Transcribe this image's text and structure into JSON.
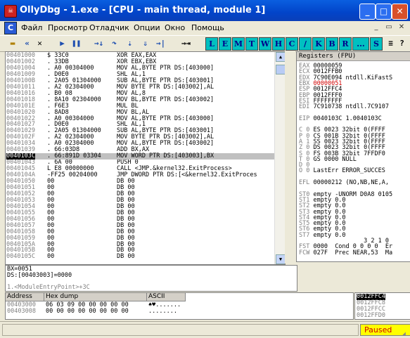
{
  "window": {
    "title": "OllyDbg - 1.exe - [CPU - main thread, module 1]",
    "app_icon": "ollydbg-bug-icon",
    "min": "_",
    "max": "□",
    "close": "✕"
  },
  "menu": {
    "items": [
      "Файл",
      "Просмотр",
      "Отладчик",
      "Опции",
      "Окно",
      "Помощь"
    ],
    "child_icon": "C",
    "mdi": [
      "_",
      "▭",
      "✕"
    ]
  },
  "toolbar": {
    "open": "open-folder-icon",
    "rewind": "«",
    "close_file": "✕",
    "run": "▶",
    "pause": "❚❚",
    "step_into": "→↓",
    "step_over": "↷",
    "trace_into": "⇣",
    "trace_over": "⇓",
    "exec_till_return": "→|",
    "goto": "→⇥",
    "windows": [
      "L",
      "E",
      "M",
      "T",
      "W",
      "H",
      "C",
      "/",
      "K",
      "B",
      "R",
      "...",
      "S"
    ],
    "extra": "≡",
    "help": "?"
  },
  "disasm": [
    {
      "addr": "00401000",
      "hex": "$ 33C0",
      "asm": "XOR EAX,EAX"
    },
    {
      "addr": "00401002",
      "hex": ". 33DB",
      "asm": "XOR EBX,EBX"
    },
    {
      "addr": "00401004",
      "hex": ". A0 00304000",
      "asm": "MOV AL,BYTE PTR DS:[403000]"
    },
    {
      "addr": "00401009",
      "hex": ". D0E0",
      "asm": "SHL AL,1"
    },
    {
      "addr": "0040100B",
      "hex": ". 2A05 01304000",
      "asm": "SUB AL,BYTE PTR DS:[403001]"
    },
    {
      "addr": "00401011",
      "hex": ". A2 02304000",
      "asm": "MOV BYTE PTR DS:[403002],AL"
    },
    {
      "addr": "00401016",
      "hex": ". B0 08",
      "asm": "MOV AL,8"
    },
    {
      "addr": "00401018",
      "hex": ". 8A10 02304000",
      "asm": "MOV BL,BYTE PTR DS:[403002]"
    },
    {
      "addr": "0040101E",
      "hex": ". F6E3",
      "asm": "MUL BL"
    },
    {
      "addr": "00401020",
      "hex": ". 8AD8",
      "asm": "MOV BL,AL"
    },
    {
      "addr": "00401022",
      "hex": ". A0 00304000",
      "asm": "MOV AL,BYTE PTR DS:[403000]"
    },
    {
      "addr": "00401027",
      "hex": ". D0E0",
      "asm": "SHL AL,1"
    },
    {
      "addr": "00401029",
      "hex": ". 2A05 01304000",
      "asm": "SUB AL,BYTE PTR DS:[403001]"
    },
    {
      "addr": "0040102F",
      "hex": ". A2 02304000",
      "asm": "MOV BYTE PTR DS:[403002],AL"
    },
    {
      "addr": "00401034",
      "hex": ". A0 02304000",
      "asm": "MOV AL,BYTE PTR DS:[403002]"
    },
    {
      "addr": "00401039",
      "hex": ". 66:03D8",
      "asm": "ADD BX,AX"
    },
    {
      "addr": "0040103C",
      "hex": ". 66:891D 03304",
      "asm": "MOV WORD PTR DS:[403003],BX"
    },
    {
      "addr": "00401043",
      "hex": ". 6A 00",
      "asm": "PUSH 0"
    },
    {
      "addr": "00401045",
      "hex": "L E8 00000000",
      "asm": "CALL <JMP.&kernel32.ExitProcess>"
    },
    {
      "addr": "0040104A",
      "hex": "-FF25 00204000",
      "asm": "JMP DWORD PTR DS:[<&kernel32.ExitProces"
    },
    {
      "addr": "00401050",
      "hex": "00",
      "asm": "DB 00"
    },
    {
      "addr": "00401051",
      "hex": "00",
      "asm": "DB 00"
    },
    {
      "addr": "00401052",
      "hex": "00",
      "asm": "DB 00"
    },
    {
      "addr": "00401053",
      "hex": "00",
      "asm": "DB 00"
    },
    {
      "addr": "00401054",
      "hex": "00",
      "asm": "DB 00"
    },
    {
      "addr": "00401055",
      "hex": "00",
      "asm": "DB 00"
    },
    {
      "addr": "00401056",
      "hex": "00",
      "asm": "DB 00"
    },
    {
      "addr": "00401057",
      "hex": "00",
      "asm": "DB 00"
    },
    {
      "addr": "00401058",
      "hex": "00",
      "asm": "DB 00"
    },
    {
      "addr": "00401059",
      "hex": "00",
      "asm": "DB 00"
    },
    {
      "addr": "0040105A",
      "hex": "00",
      "asm": "DB 00"
    },
    {
      "addr": "0040105B",
      "hex": "00",
      "asm": "DB 00"
    },
    {
      "addr": "0040105C",
      "hex": "00",
      "asm": "DB 00"
    }
  ],
  "selected_row": 16,
  "registers": {
    "header": "Registers (FPU)",
    "lines": [
      {
        "n": "EAX",
        "v": "00000059",
        "red": false
      },
      {
        "n": "ECX",
        "v": "0012FFB0",
        "red": false
      },
      {
        "n": "EDX",
        "v": "7C90E094 ntdll.KiFastS",
        "red": false
      },
      {
        "n": "EBX",
        "v": "00000051",
        "red": true
      },
      {
        "n": "ESP",
        "v": "0012FFC4",
        "red": false
      },
      {
        "n": "EBP",
        "v": "0012FFF0",
        "red": false
      },
      {
        "n": "ESI",
        "v": "FFFFFFFF",
        "red": false
      },
      {
        "n": "EDI",
        "v": "7C910738 ntdll.7C9107",
        "red": false
      },
      {
        "n": "",
        "v": "",
        "red": false
      },
      {
        "n": "EIP",
        "v": "0040103C 1.0040103C",
        "red": false
      },
      {
        "n": "",
        "v": "",
        "red": false
      },
      {
        "n": "C 0",
        "v": "ES 0023 32bit 0(FFFF",
        "red": false
      },
      {
        "n": "P 0",
        "v": "CS 001B 32bit 0(FFFF",
        "red": false
      },
      {
        "n": "A 1",
        "v": "SS 0023 32bit 0(FFFF",
        "red": false
      },
      {
        "n": "Z 0",
        "v": "DS 0023 32bit 0(FFFF",
        "red": false
      },
      {
        "n": "S 0",
        "v": "FS 003B 32bit 7FFDF0",
        "red": false
      },
      {
        "n": "T 0",
        "v": "GS 0000 NULL",
        "red": false
      },
      {
        "n": "D 0",
        "v": "",
        "red": false
      },
      {
        "n": "O 0",
        "v": "LastErr ERROR_SUCCES",
        "red": false
      },
      {
        "n": "",
        "v": "",
        "red": false
      },
      {
        "n": "EFL",
        "v": "00000212 (NO,NB,NE,A,",
        "red": false
      },
      {
        "n": "",
        "v": "",
        "red": false
      },
      {
        "n": "ST0",
        "v": "empty -UNORM D0A8 0105",
        "red": false
      },
      {
        "n": "ST1",
        "v": "empty 0.0",
        "red": false
      },
      {
        "n": "ST2",
        "v": "empty 0.0",
        "red": false
      },
      {
        "n": "ST3",
        "v": "empty 0.0",
        "red": false
      },
      {
        "n": "ST4",
        "v": "empty 0.0",
        "red": false
      },
      {
        "n": "ST5",
        "v": "empty 0.0",
        "red": false
      },
      {
        "n": "ST6",
        "v": "empty 0.0",
        "red": false
      },
      {
        "n": "ST7",
        "v": "empty 0.0",
        "red": false
      },
      {
        "n": "",
        "v": "              3 2 1 0",
        "red": false
      },
      {
        "n": "FST",
        "v": "0000  Cond 0 0 0 0  Er",
        "red": false
      },
      {
        "n": "FCW",
        "v": "027F  Prec NEAR,53  Ma",
        "red": false
      }
    ]
  },
  "info": {
    "line1": "BX=0051",
    "line2": "DS:[00403003]=0000",
    "line3": "1.<ModuleEntryPoint>+3C"
  },
  "dump": {
    "col_address": "Address",
    "col_hex": "Hex dump",
    "col_ascii": "ASCII",
    "rows": [
      {
        "addr": "00403000",
        "hex": "06 03 09 00 00 00 00 00",
        "ascii": "♠♥.......",
        "ascii_color": "#000"
      },
      {
        "addr": "00403008",
        "hex": "00 00 00 00 00 00 00 00",
        "ascii": "........",
        "ascii_color": "#000"
      }
    ]
  },
  "stack": {
    "rows": [
      {
        "v": "0012FFC4",
        "hl": true
      },
      {
        "v": "0012FFC8",
        "hl": false
      },
      {
        "v": "0012FFCC",
        "hl": false
      },
      {
        "v": "0012FFD0",
        "hl": false
      }
    ]
  },
  "status": {
    "message": "",
    "state": "Paused"
  }
}
